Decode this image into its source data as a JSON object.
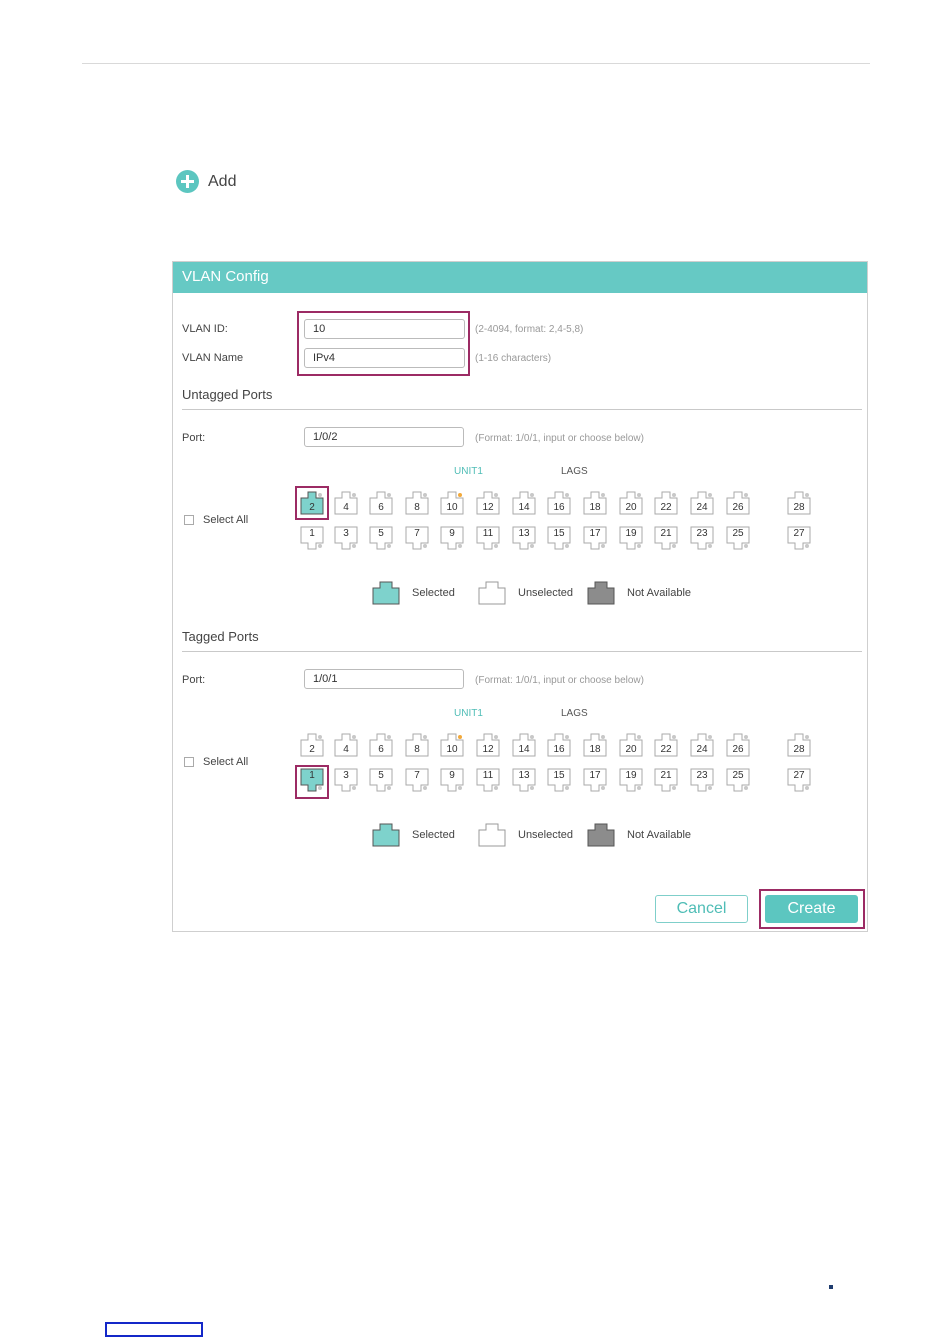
{
  "add": {
    "label": "Add"
  },
  "panel": {
    "title": "VLAN Config",
    "vlan_id": {
      "label": "VLAN ID:",
      "value": "10",
      "hint": "(2-4094, format: 2,4-5,8)"
    },
    "vlan_name": {
      "label": "VLAN Name",
      "value": "IPv4",
      "hint": "(1-16 characters)"
    },
    "untagged": {
      "title": "Untagged Ports",
      "port_label": "Port:",
      "port_value": "1/0/2",
      "port_hint": "(Format: 1/0/1, input or choose below)",
      "unit_label": "UNIT1",
      "lags_label": "LAGS",
      "select_all": "Select All",
      "selected_ports": [
        "2"
      ]
    },
    "tagged": {
      "title": "Tagged Ports",
      "port_label": "Port:",
      "port_value": "1/0/1",
      "port_hint": "(Format: 1/0/1, input or choose below)",
      "unit_label": "UNIT1",
      "lags_label": "LAGS",
      "select_all": "Select All",
      "selected_ports": [
        "1"
      ]
    },
    "ports_even": [
      "2",
      "4",
      "6",
      "8",
      "10",
      "12",
      "14",
      "16",
      "18",
      "20",
      "22",
      "24",
      "26",
      "28"
    ],
    "ports_odd": [
      "1",
      "3",
      "5",
      "7",
      "9",
      "11",
      "13",
      "15",
      "17",
      "19",
      "21",
      "23",
      "25",
      "27"
    ],
    "amber_led_port": "10",
    "legend": {
      "selected": "Selected",
      "unselected": "Unselected",
      "not_available": "Not Available"
    },
    "buttons": {
      "cancel": "Cancel",
      "create": "Create"
    }
  },
  "colors": {
    "accent": "#66c9c4",
    "selected_port": "#7ed2cc",
    "not_available": "#8c8c8c",
    "highlight": "#9c2b64"
  }
}
